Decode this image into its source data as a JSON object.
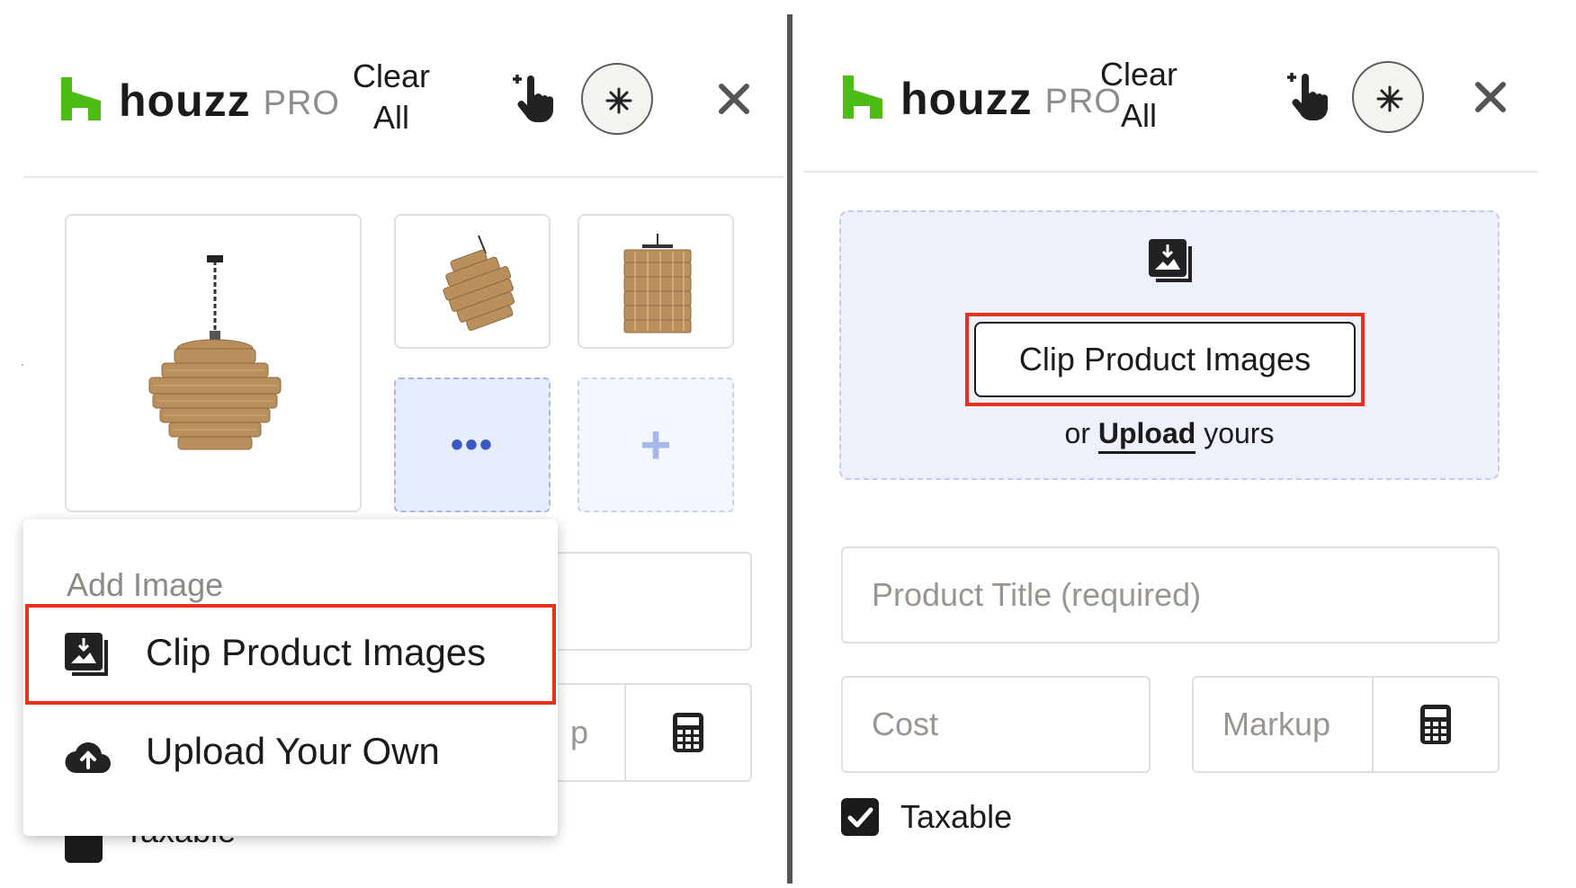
{
  "brand": {
    "name": "houzz",
    "suffix": "PRO",
    "accent": "#4dbc15"
  },
  "header": {
    "clear_all_line1": "Clear",
    "clear_all_line2": "All"
  },
  "left": {
    "add_image_menu": {
      "title": "Add Image",
      "items": [
        {
          "label": "Clip Product Images",
          "icon": "clip-image-icon",
          "highlighted": true
        },
        {
          "label": "Upload Your Own",
          "icon": "cloud-upload-icon"
        }
      ]
    },
    "more_tile_label": "•••",
    "add_tile_label": "+",
    "partial_markup_text": "p",
    "partial_taxable_text": "Taxable"
  },
  "right": {
    "clip_button_label": "Clip Product Images",
    "upload_prefix": "or",
    "upload_link": "Upload",
    "upload_suffix": "yours",
    "product_title_placeholder": "Product Title (required)",
    "cost_placeholder": "Cost",
    "markup_placeholder": "Markup",
    "taxable_label": "Taxable",
    "taxable_checked": true
  },
  "colors": {
    "highlight_border": "#e8321f",
    "dashed_border": "#a8b8e0"
  }
}
